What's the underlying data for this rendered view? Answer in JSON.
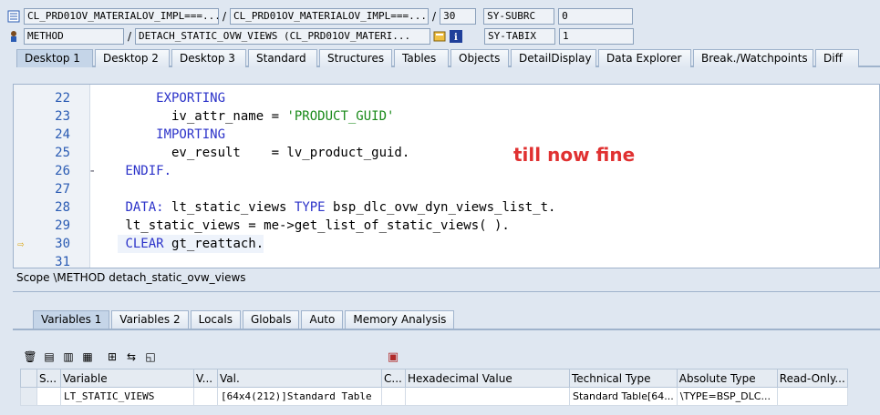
{
  "header": {
    "program_icon": "program-icon",
    "row1": {
      "field1": "CL_PRD01OV_MATERIALOV_IMPL===...",
      "field2": "CL_PRD01OV_MATERIALOV_IMPL===...",
      "line": "30",
      "sysvar_name": "SY-SUBRC",
      "sysvar_value": "0"
    },
    "row2": {
      "type": "METHOD",
      "method": "DETACH_STATIC_OVW_VIEWS (CL_PRD01OV_MATERI...",
      "sysvar_name": "SY-TABIX",
      "sysvar_value": "1"
    }
  },
  "tabs": [
    "Desktop 1",
    "Desktop 2",
    "Desktop 3",
    "Standard",
    "Structures",
    "Tables",
    "Objects",
    "DetailDisplay",
    "Data Explorer",
    "Break./Watchpoints",
    "Diff"
  ],
  "code_lines": [
    {
      "num": "22",
      "fold": "",
      "code": "     EXPORTING"
    },
    {
      "num": "23",
      "fold": "",
      "code": "       iv_attr_name = 'PRODUCT_GUID'"
    },
    {
      "num": "24",
      "fold": "",
      "code": "     IMPORTING"
    },
    {
      "num": "25",
      "fold": "",
      "code": "       ev_result    = lv_product_guid."
    },
    {
      "num": "26",
      "fold": "-",
      "code": " ENDIF."
    },
    {
      "num": "27",
      "fold": "",
      "code": ""
    },
    {
      "num": "28",
      "fold": "",
      "code": " DATA: lt_static_views TYPE bsp_dlc_ovw_dyn_views_list_t."
    },
    {
      "num": "29",
      "fold": "",
      "code": " lt_static_views = me->get_list_of_static_views( )."
    },
    {
      "num": "30",
      "fold": "",
      "code": " CLEAR gt_reattach."
    },
    {
      "num": "31",
      "fold": "",
      "code": ""
    }
  ],
  "annotation": "till now fine",
  "scope": "Scope \\METHOD detach_static_ovw_views",
  "bottom_tabs": [
    "Variables 1",
    "Variables 2",
    "Locals",
    "Globals",
    "Auto",
    "Memory Analysis"
  ],
  "grid": {
    "headers": [
      "S...",
      "Variable",
      "V...",
      "Val.",
      "C...",
      "Hexadecimal Value",
      "Technical Type",
      "Absolute Type",
      "Read-Only..."
    ],
    "rows": [
      {
        "s": "",
        "variable": "LT_STATIC_VIEWS",
        "v": "",
        "val": "[64x4(212)]Standard Table",
        "c": "",
        "hex": "",
        "tech": "Standard Table[64...",
        "abs": "\\TYPE=BSP_DLC...",
        "ro": ""
      }
    ]
  }
}
